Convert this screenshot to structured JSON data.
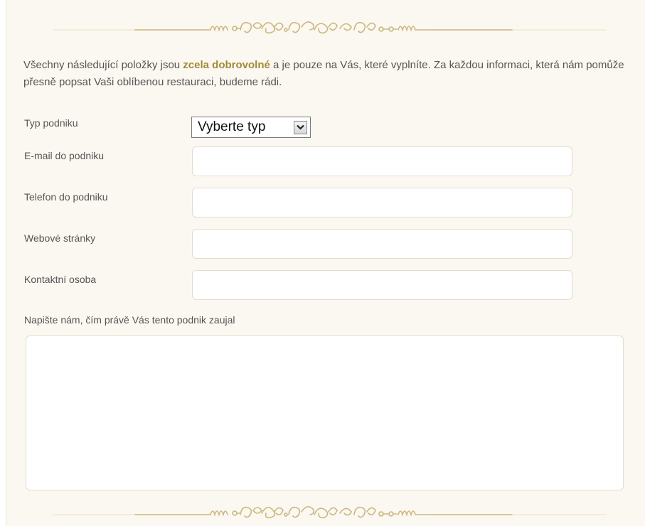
{
  "intro": {
    "text_before": "Všechny následující položky jsou ",
    "emphasis": "zcela dobrovolné",
    "text_after": " a je pouze na Vás, které vyplníte. Za každou informaci, která nám pomůže přesně popsat Vaši oblíbenou restauraci, budeme rádi."
  },
  "form": {
    "type_label": "Typ podniku",
    "type_select_value": "Vyberte typ",
    "email_label": "E-mail do podniku",
    "email_value": "",
    "phone_label": "Telefon do podniku",
    "phone_value": "",
    "web_label": "Webové stránky",
    "web_value": "",
    "contact_label": "Kontaktní osoba",
    "contact_value": "",
    "message_label": "Napište nám, čím právě Vás tento podnik zaujal",
    "message_value": ""
  },
  "colors": {
    "panel_background": "#fbf8f1",
    "ornament": "#cbb77d",
    "emphasis": "#a08a38",
    "text": "#555555"
  },
  "icons": {
    "select_arrow": "chevron-down-icon",
    "divider": "flourish-divider"
  }
}
